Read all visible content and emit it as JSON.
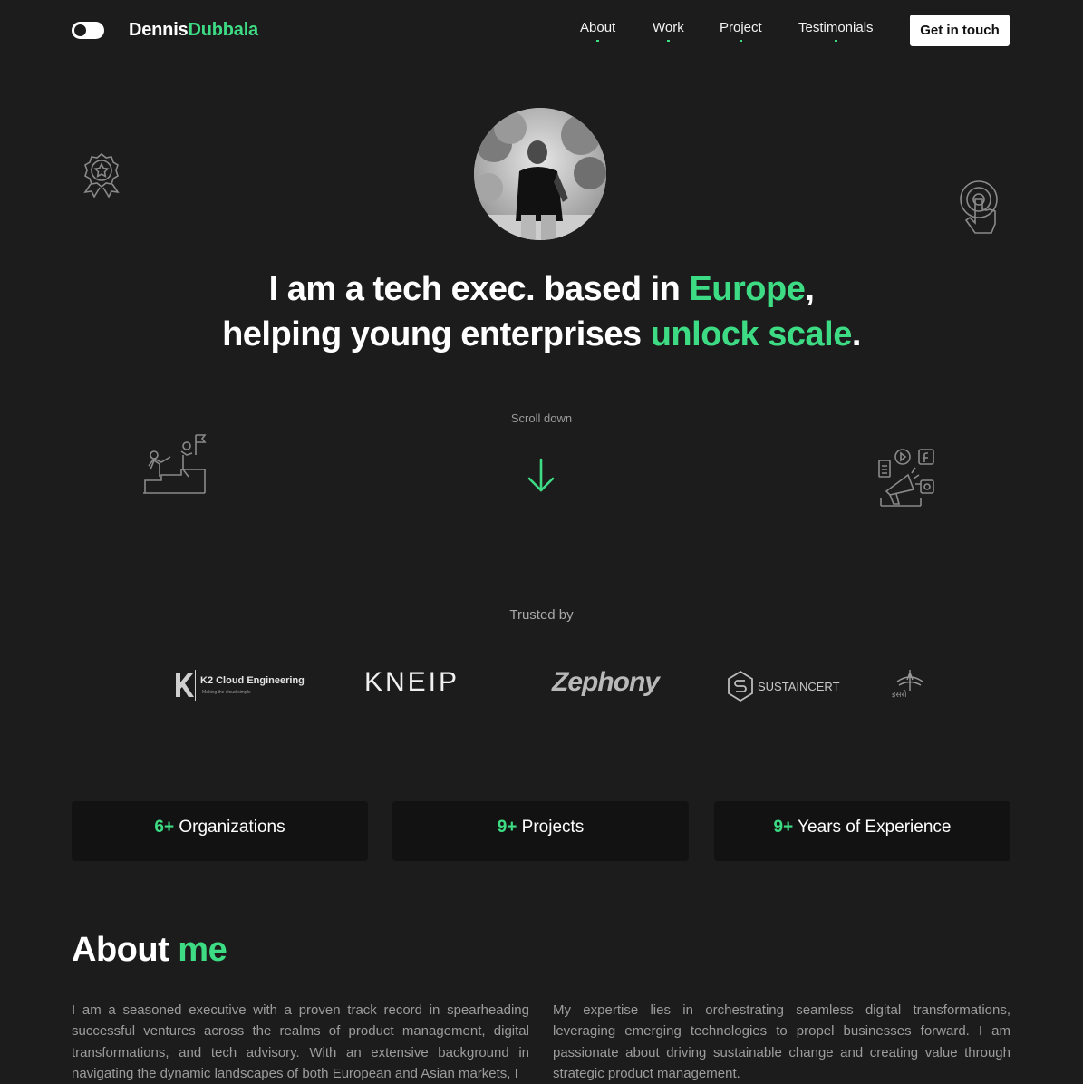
{
  "nav": {
    "brand_first": "Dennis",
    "brand_last": "Dubbala",
    "links": [
      "About",
      "Work",
      "Project",
      "Testimonials"
    ],
    "cta": "Get in touch"
  },
  "hero": {
    "line1_pre": "I am a tech exec. based in ",
    "line1_accent": "Europe",
    "line1_post": ",",
    "line2_pre": "helping young enterprises ",
    "line2_accent": "unlock scale",
    "line2_post": "."
  },
  "scroll": {
    "label": "Scroll down"
  },
  "trusted": {
    "label": "Trusted by",
    "logos": [
      {
        "name": "K2 Cloud Engineering",
        "tagline": "Making the cloud simple"
      },
      {
        "name": "KNEIP"
      },
      {
        "name": "Zephony"
      },
      {
        "name": "SUSTAINCERT"
      },
      {
        "name": "इसरो"
      }
    ]
  },
  "stats": [
    {
      "number": "6+",
      "label": "Organizations"
    },
    {
      "number": "9+",
      "label": "Projects"
    },
    {
      "number": "9+",
      "label": "Years of Experience"
    }
  ],
  "about": {
    "title_pre": "About ",
    "title_accent": "me",
    "col1": "I am a seasoned executive with a proven track record in spearheading successful ventures across the realms of product management, digital transformations, and tech advisory. With an extensive background in navigating the dynamic landscapes of both European and Asian markets, I",
    "col2": "My expertise lies in orchestrating seamless digital transformations, leveraging emerging technologies to propel businesses forward. I am passionate about driving sustainable change and creating value through strategic product management."
  },
  "icons": {
    "theme_toggle": "toggle-icon",
    "award": "award-badge-icon",
    "touch": "touch-target-icon",
    "teamwork": "teamwork-flag-icon",
    "marketing": "digital-marketing-icon",
    "scroll": "arrow-down-icon"
  },
  "colors": {
    "accent": "#3ddc84",
    "background": "#1c1c1c",
    "card": "#121212"
  }
}
